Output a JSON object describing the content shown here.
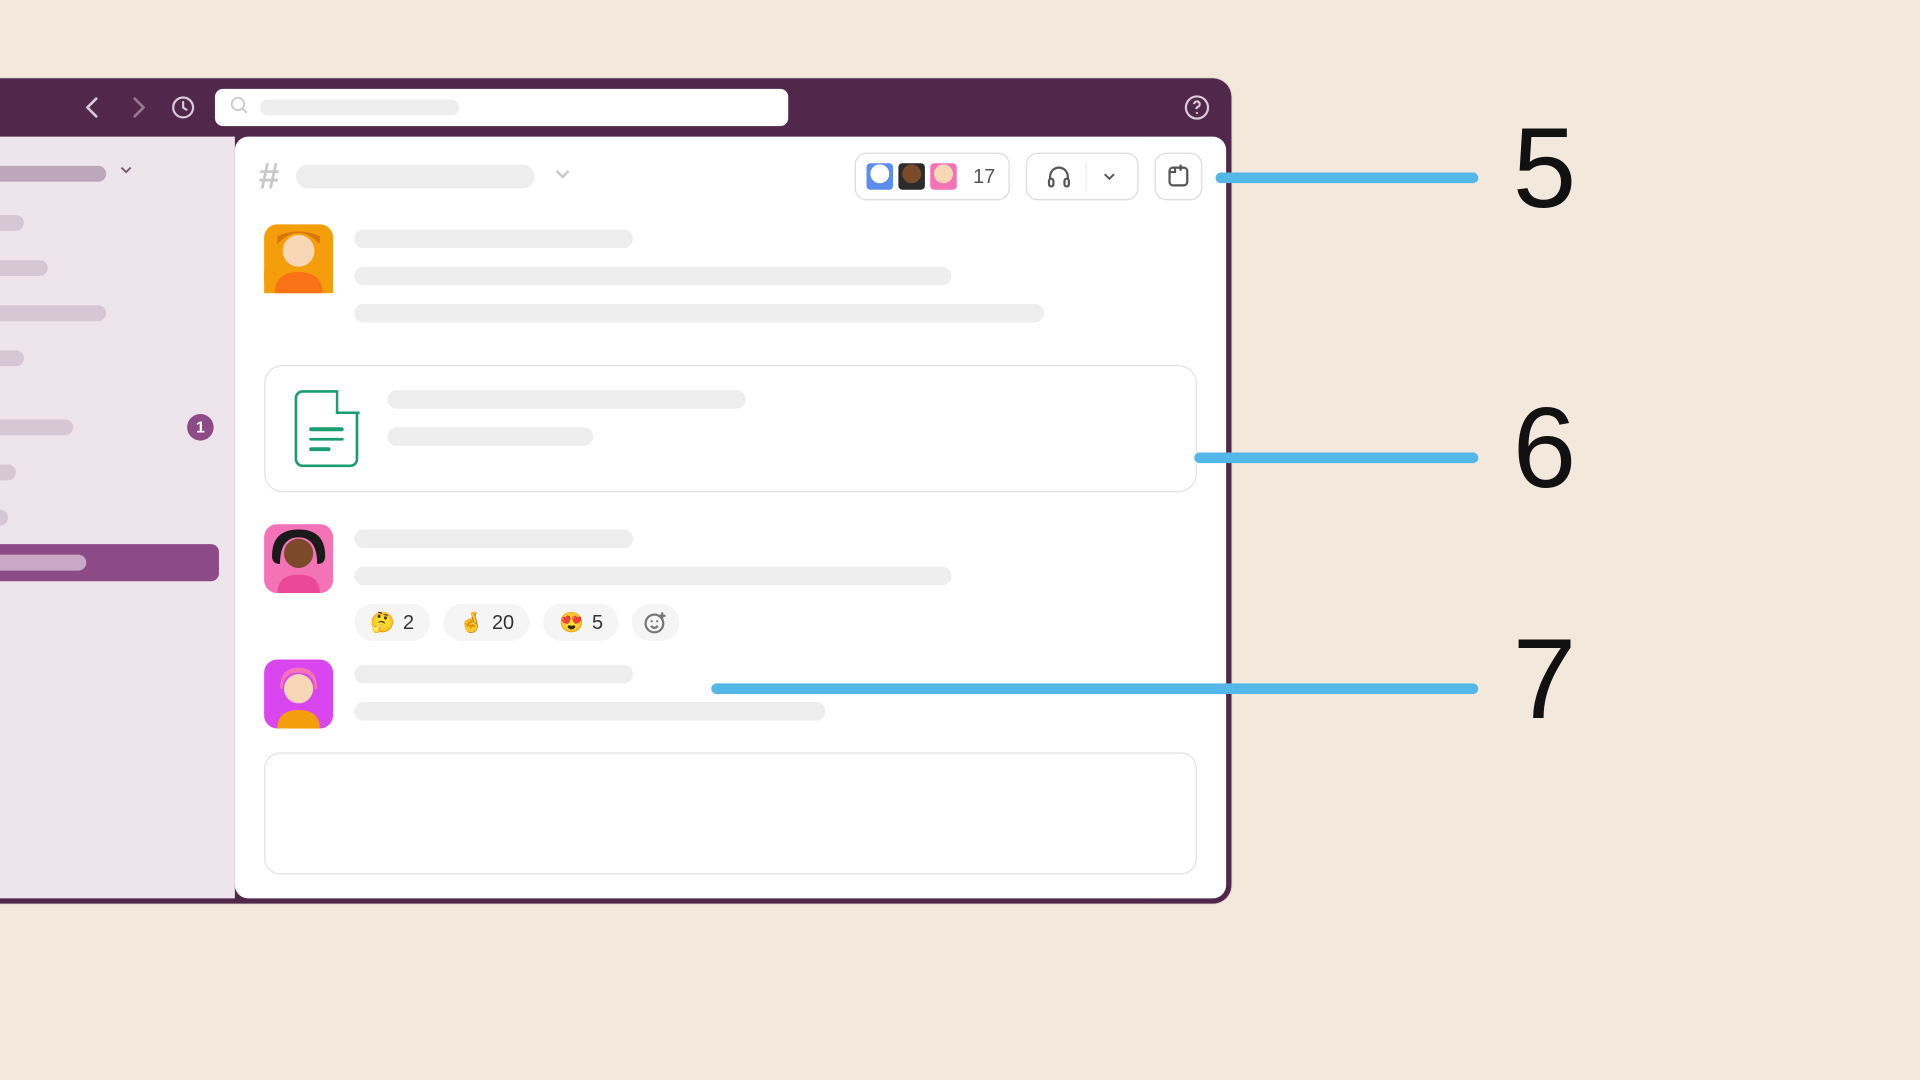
{
  "sidebar": {
    "badge_count": "1"
  },
  "channel_header": {
    "member_count": "17"
  },
  "reactions": [
    {
      "emoji": "🤔",
      "count": "2"
    },
    {
      "emoji": "🤞",
      "count": "20"
    },
    {
      "emoji": "😍",
      "count": "5"
    }
  ],
  "callouts": {
    "five": "5",
    "six": "6",
    "seven": "7"
  }
}
